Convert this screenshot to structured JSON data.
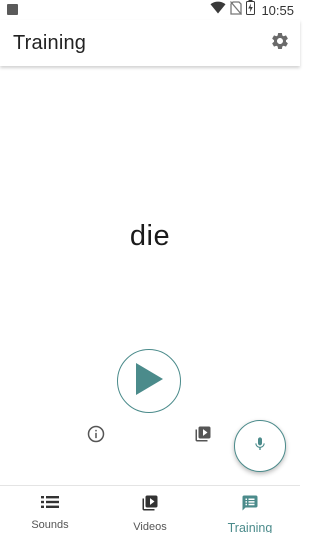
{
  "status_bar": {
    "time": "10:55",
    "icons": [
      "notification-square-icon",
      "wifi-icon",
      "no-sim-icon",
      "battery-charging-icon"
    ]
  },
  "app_bar": {
    "title": "Training",
    "settings_icon": "gear-icon"
  },
  "main": {
    "word": "die",
    "play_icon": "play-icon",
    "info_icon": "info-icon",
    "video_icon": "video-library-icon",
    "mic_icon": "mic-icon"
  },
  "bottom_nav": {
    "items": [
      {
        "label": "Sounds",
        "icon": "list-icon",
        "active": false
      },
      {
        "label": "Videos",
        "icon": "video-library-icon",
        "active": false
      },
      {
        "label": "Training",
        "icon": "chat-list-icon",
        "active": true
      }
    ]
  },
  "colors": {
    "accent": "#4b8b8b",
    "text": "#222222",
    "icon_gray": "#5a5a5a"
  }
}
